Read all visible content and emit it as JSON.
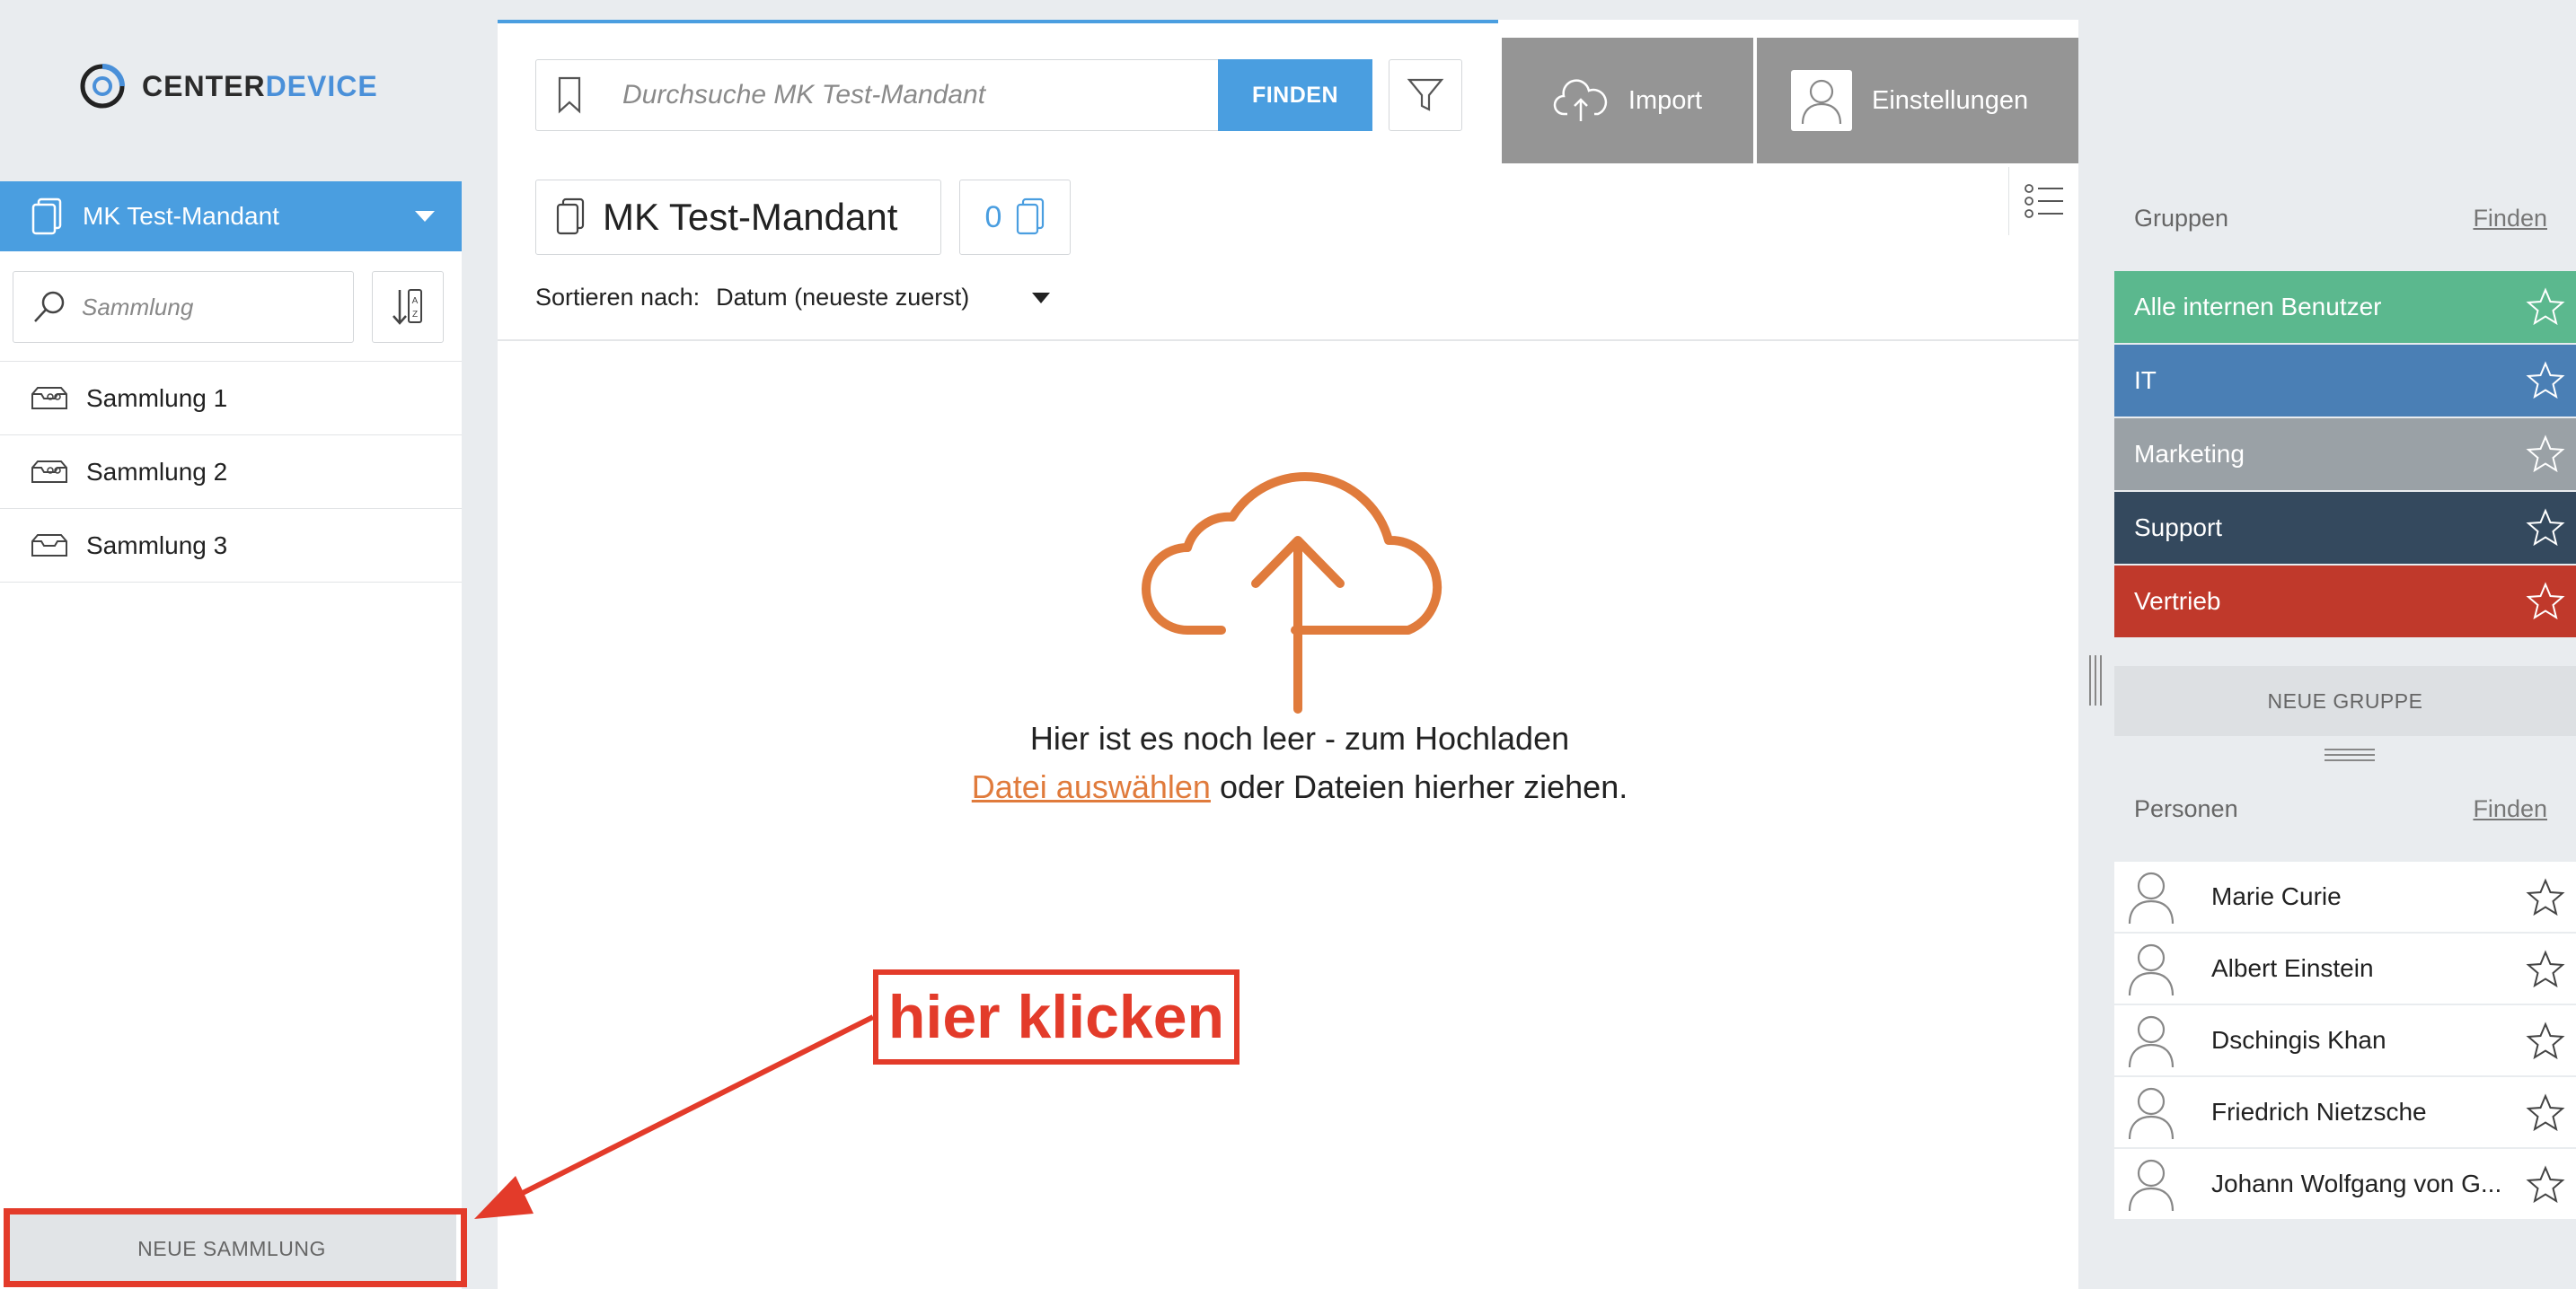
{
  "brand": {
    "logo_word1": "CENTER",
    "logo_word2": "DEVICE",
    "accent": "#4a9ee0",
    "orange": "#e07b3c",
    "annotation_red": "#e33b2a"
  },
  "tenant": {
    "name": "MK Test-Mandant",
    "icon": "documents-icon"
  },
  "collections": {
    "search_placeholder": "Sammlung",
    "items": [
      {
        "label": "Sammlung 1",
        "icon": "shared-collection-icon"
      },
      {
        "label": "Sammlung 2",
        "icon": "shared-collection-icon"
      },
      {
        "label": "Sammlung 3",
        "icon": "collection-icon"
      }
    ],
    "new_button": "NEUE SAMMLUNG"
  },
  "toolbar": {
    "search_placeholder": "Durchsuche MK Test-Mandant",
    "find_button": "FINDEN",
    "import_button": "Import",
    "settings_button": "Einstellungen"
  },
  "main": {
    "title": "MK Test-Mandant",
    "doc_count": "0",
    "sort_label": "Sortieren nach:",
    "sort_value": "Datum (neueste zuerst)",
    "empty_line1": "Hier ist es noch leer - zum Hochladen",
    "empty_link": "Datei auswählen",
    "empty_line2_rest": " oder Dateien hierher ziehen."
  },
  "annotation": {
    "callout": "hier klicken"
  },
  "groups": {
    "heading": "Gruppen",
    "find_link": "Finden",
    "items": [
      {
        "label": "Alle internen Benutzer",
        "color": "#5bb88e"
      },
      {
        "label": "IT",
        "color": "#4a7fb5"
      },
      {
        "label": "Marketing",
        "color": "#9aa1a6"
      },
      {
        "label": "Support",
        "color": "#34495e"
      },
      {
        "label": "Vertrieb",
        "color": "#c0392b"
      }
    ],
    "new_button": "NEUE GRUPPE"
  },
  "people": {
    "heading": "Personen",
    "find_link": "Finden",
    "items": [
      {
        "name": "Marie Curie"
      },
      {
        "name": "Albert Einstein"
      },
      {
        "name": "Dschingis Khan"
      },
      {
        "name": "Friedrich Nietzsche"
      },
      {
        "name": "Johann Wolfgang von G..."
      }
    ]
  }
}
